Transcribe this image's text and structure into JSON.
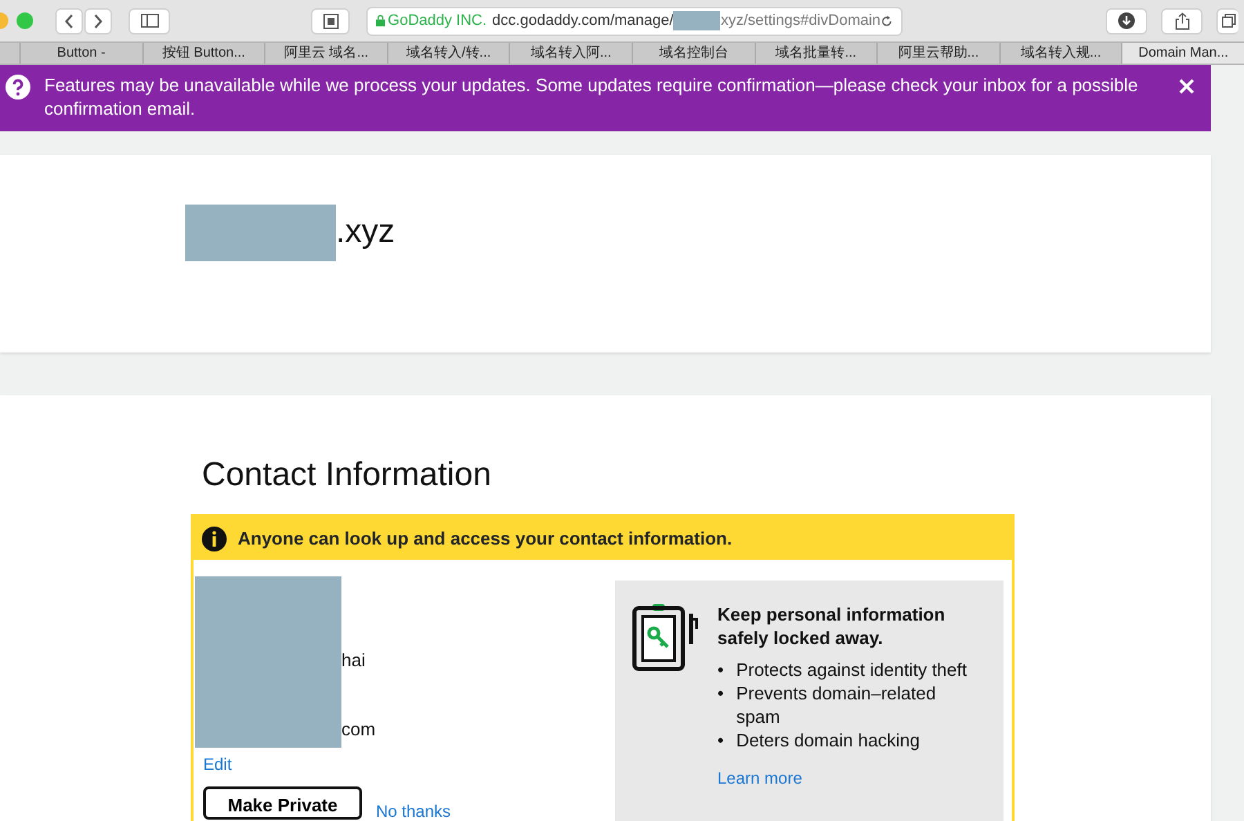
{
  "browser": {
    "secure_label": "GoDaddy INC.",
    "url_start": "dcc.godaddy.com/manage/",
    "url_end": "xyz/settings#divDomain"
  },
  "tabs": [
    {
      "label": "Button -",
      "selected": false
    },
    {
      "label": "按钮 Button...",
      "selected": false
    },
    {
      "label": "阿里云 域名...",
      "selected": false
    },
    {
      "label": "域名转入/转...",
      "selected": false
    },
    {
      "label": "域名转入阿...",
      "selected": false
    },
    {
      "label": "域名控制台",
      "selected": false
    },
    {
      "label": "域名批量转...",
      "selected": false
    },
    {
      "label": "阿里云帮助...",
      "selected": false
    },
    {
      "label": "域名转入规...",
      "selected": false
    },
    {
      "label": "Domain Man...",
      "selected": true
    }
  ],
  "notice": {
    "text": "Features may be unavailable while we process your updates. Some updates require confirmation—please check your inbox for a possible confirmation email."
  },
  "domain": {
    "suffix": ".xyz"
  },
  "contact": {
    "title": "Contact Information",
    "warning": "Anyone can look up and access your contact information.",
    "lines": [
      "hai",
      "com"
    ],
    "edit": "Edit",
    "primary_button": "Make Private",
    "secondary_link": "No thanks",
    "promo": {
      "heading": "Keep personal information safely locked away.",
      "bullets": [
        {
          "marker": "•",
          "text": "Protects against identity theft"
        },
        {
          "marker": "•",
          "text": "Prevents domain–related spam"
        },
        {
          "marker": "•",
          "text": "Deters domain hacking"
        }
      ],
      "link": "Learn more"
    }
  }
}
